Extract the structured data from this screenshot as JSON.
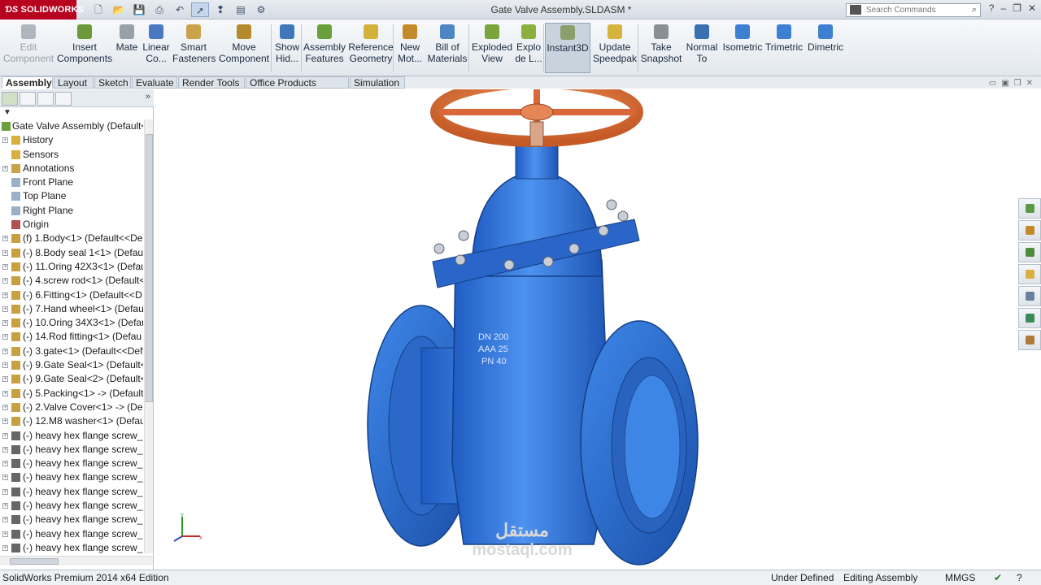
{
  "app": {
    "brand": "SOLIDWORKS",
    "window_title": "Gate Valve Assembly.SLDASM *"
  },
  "search": {
    "placeholder": "Search Commands"
  },
  "commands": [
    {
      "name": "edit-component-button",
      "label": "Edit Component",
      "state": "disabled",
      "icon": "edit-component-icon",
      "color": "#b0b6bd"
    },
    {
      "name": "insert-components-button",
      "label": "Insert Components",
      "state": "normal",
      "icon": "insert-components-icon",
      "color": "#6c9a3a"
    },
    {
      "name": "mate-button",
      "label": "Mate",
      "state": "normal",
      "icon": "mate-icon",
      "color": "#9aa0a8"
    },
    {
      "name": "linear-component-pattern-button",
      "label": "Linear Co...",
      "state": "normal",
      "icon": "linear-pattern-icon",
      "color": "#4a79c2"
    },
    {
      "name": "smart-fasteners-button",
      "label": "Smart Fasteners",
      "state": "normal",
      "icon": "smart-fasteners-icon",
      "color": "#c9a24a"
    },
    {
      "name": "move-component-button",
      "label": "Move Component",
      "state": "normal",
      "icon": "move-component-icon",
      "color": "#b58a2e"
    },
    {
      "name": "show-hidden-button",
      "label": "Show Hid...",
      "state": "normal",
      "icon": "show-hidden-icon",
      "color": "#3f78b8"
    },
    {
      "name": "assembly-features-button",
      "label": "Assembly Features",
      "state": "normal",
      "icon": "assembly-features-icon",
      "color": "#6aa03c"
    },
    {
      "name": "reference-geometry-button",
      "label": "Reference Geometry",
      "state": "normal",
      "icon": "reference-geometry-icon",
      "color": "#d2b23a"
    },
    {
      "name": "new-motion-study-button",
      "label": "New Mot...",
      "state": "normal",
      "icon": "motion-study-icon",
      "color": "#c48a2a"
    },
    {
      "name": "bill-of-materials-button",
      "label": "Bill of Materials",
      "state": "normal",
      "icon": "bom-icon",
      "color": "#4c86c4"
    },
    {
      "name": "exploded-view-button",
      "label": "Exploded View",
      "state": "normal",
      "icon": "exploded-view-icon",
      "color": "#79a53a"
    },
    {
      "name": "explode-line-sketch-button",
      "label": "Explo de L...",
      "state": "normal",
      "icon": "explode-line-icon",
      "color": "#8cb040"
    },
    {
      "name": "instant3d-button",
      "label": "Instant3D",
      "state": "active",
      "icon": "instant3d-icon",
      "color": "#8a9f6a"
    },
    {
      "name": "update-speedpak-button",
      "label": "Update Speedpak",
      "state": "normal",
      "icon": "speedpak-icon",
      "color": "#d4b43c"
    },
    {
      "name": "take-snapshot-button",
      "label": "Take Snapshot",
      "state": "normal",
      "icon": "snapshot-icon",
      "color": "#8a8f96"
    },
    {
      "name": "normal-to-button",
      "label": "Normal To",
      "state": "normal",
      "icon": "normal-to-icon",
      "color": "#3a6fb0"
    },
    {
      "name": "isometric-button",
      "label": "Isometric",
      "state": "normal",
      "icon": "isometric-icon",
      "color": "#3d7fd0"
    },
    {
      "name": "trimetric-button",
      "label": "Trimetric",
      "state": "normal",
      "icon": "trimetric-icon",
      "color": "#3d7fd0"
    },
    {
      "name": "dimetric-button",
      "label": "Dimetric",
      "state": "normal",
      "icon": "dimetric-icon",
      "color": "#3d7fd0"
    }
  ],
  "tabs": [
    "Assembly",
    "Layout",
    "Sketch",
    "Evaluate",
    "Render Tools",
    "Office Products",
    "Simulation"
  ],
  "active_tab": "Assembly",
  "tree": {
    "root": "Gate Valve Assembly  (Default<",
    "items": [
      {
        "label": "History",
        "icon": "history-folder-icon",
        "exp": true
      },
      {
        "label": "Sensors",
        "icon": "sensors-folder-icon",
        "exp": false
      },
      {
        "label": "Annotations",
        "icon": "annotations-icon",
        "exp": true
      },
      {
        "label": "Front Plane",
        "icon": "plane-icon",
        "exp": false
      },
      {
        "label": "Top Plane",
        "icon": "plane-icon",
        "exp": false
      },
      {
        "label": "Right Plane",
        "icon": "plane-icon",
        "exp": false
      },
      {
        "label": "Origin",
        "icon": "origin-icon",
        "exp": false
      },
      {
        "label": "(f) 1.Body<1> (Default<<De",
        "icon": "part-icon",
        "exp": true
      },
      {
        "label": "(-) 8.Body seal 1<1> (Defaul",
        "icon": "part-icon",
        "exp": true
      },
      {
        "label": "(-) 11.Oring 42X3<1> (Defau",
        "icon": "part-icon",
        "exp": true
      },
      {
        "label": "(-) 4.screw rod<1> (Default<",
        "icon": "part-icon",
        "exp": true
      },
      {
        "label": "(-) 6.Fitting<1> (Default<<D",
        "icon": "part-icon",
        "exp": true
      },
      {
        "label": "(-) 7.Hand wheel<1> (Defaul",
        "icon": "part-icon",
        "exp": true
      },
      {
        "label": "(-) 10.Oring 34X3<1> (Defau",
        "icon": "part-icon",
        "exp": true
      },
      {
        "label": "(-) 14.Rod fitting<1> (Defau",
        "icon": "part-icon",
        "exp": true
      },
      {
        "label": "(-) 3.gate<1> (Default<<Def",
        "icon": "part-icon",
        "exp": true
      },
      {
        "label": "(-) 9.Gate Seal<1> (Default<",
        "icon": "part-icon",
        "exp": true
      },
      {
        "label": "(-) 9.Gate Seal<2> (Default<",
        "icon": "part-icon",
        "exp": true
      },
      {
        "label": "(-) 5.Packing<1> -> (Default",
        "icon": "part-icon",
        "exp": true
      },
      {
        "label": "(-) 2.Valve Cover<1> -> (De",
        "icon": "part-icon",
        "exp": true
      },
      {
        "label": "(-) 12.M8 washer<1> (Defau",
        "icon": "part-icon",
        "exp": true
      },
      {
        "label": "(-) heavy hex flange screw_ar",
        "icon": "toolbox-part-icon",
        "exp": true
      },
      {
        "label": "(-) heavy hex flange screw_ar",
        "icon": "toolbox-part-icon",
        "exp": true
      },
      {
        "label": "(-) heavy hex flange screw_ar",
        "icon": "toolbox-part-icon",
        "exp": true
      },
      {
        "label": "(-) heavy hex flange screw_ar",
        "icon": "toolbox-part-icon",
        "exp": true
      },
      {
        "label": "(-) heavy hex flange screw_ar",
        "icon": "toolbox-part-icon",
        "exp": true
      },
      {
        "label": "(-) heavy hex flange screw_ar",
        "icon": "toolbox-part-icon",
        "exp": true
      },
      {
        "label": "(-) heavy hex flange screw_ar",
        "icon": "toolbox-part-icon",
        "exp": true
      },
      {
        "label": "(-) heavy hex flange screw_ar",
        "icon": "toolbox-part-icon",
        "exp": true
      },
      {
        "label": "(-) heavy hex flange screw_ar",
        "icon": "toolbox-part-icon",
        "exp": true
      }
    ]
  },
  "model": {
    "marking_lines": [
      "DN 200",
      "AAA 25",
      "PN 40"
    ],
    "body_color": "#2f73d8",
    "wheel_color": "#e0703a"
  },
  "watermark": {
    "arabic": "مستقل",
    "latin": "mostaql.com"
  },
  "status": {
    "edition": "SolidWorks Premium 2014 x64 Edition",
    "definition": "Under Defined",
    "mode": "Editing Assembly",
    "units": "MMGS"
  }
}
